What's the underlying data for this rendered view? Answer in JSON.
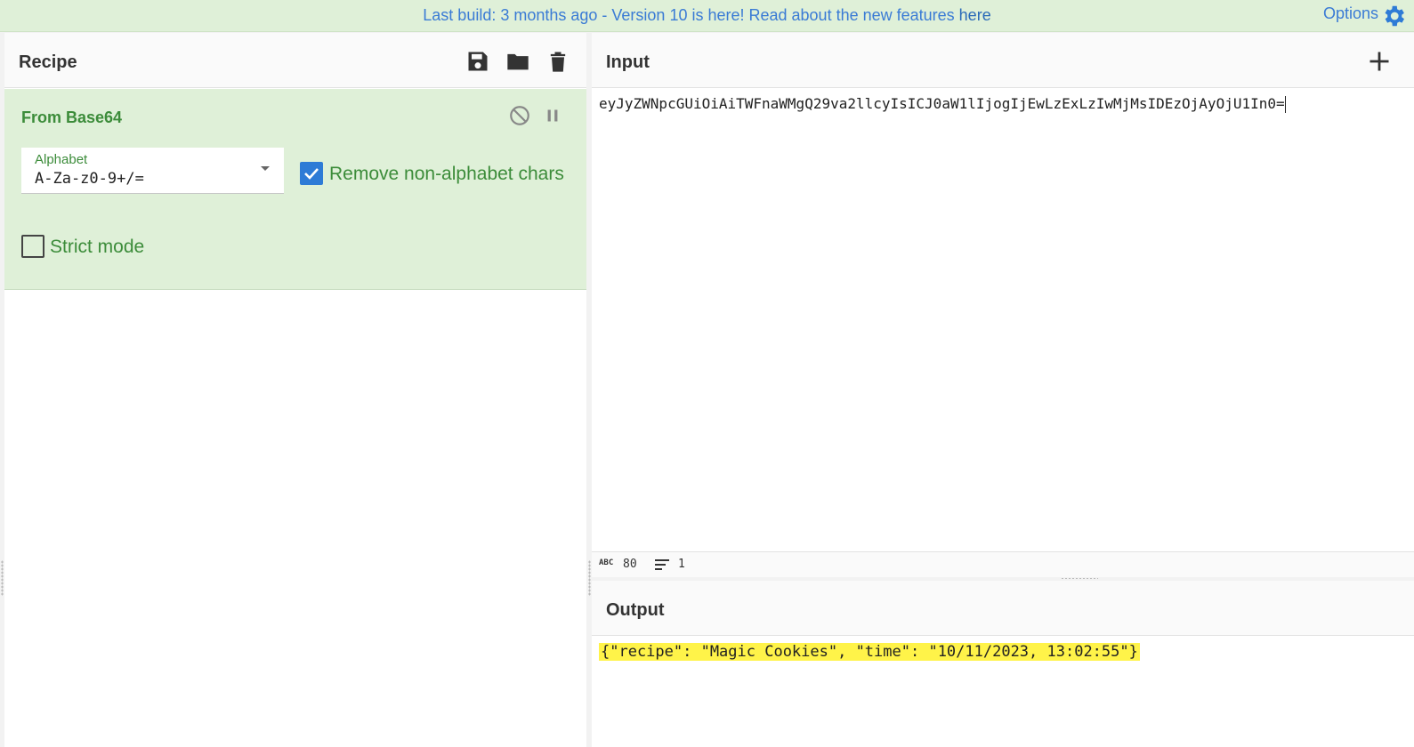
{
  "banner": {
    "text_prefix": "Last build: 3 months ago - Version 10 is here! Read about the new features ",
    "link_text": "here",
    "options_label": "Options"
  },
  "recipe": {
    "title": "Recipe",
    "tools": [
      "save-icon",
      "folder-icon",
      "trash-icon"
    ],
    "operation": {
      "title": "From Base64",
      "alphabet_label": "Alphabet",
      "alphabet_value": "A-Za-z0-9+/=",
      "remove_non_alphabet": {
        "label": "Remove non-alphabet chars",
        "checked": true
      },
      "strict_mode": {
        "label": "Strict mode",
        "checked": false
      }
    }
  },
  "input": {
    "title": "Input",
    "value": "eyJyZWNpcGUiOiAiTWFnaWMgQ29va2llcyIsICJ0aW1lIjogIjEwLzExLzIwMjMsIDEzOjAyOjU1In0=",
    "status": {
      "length_badge": "ABC",
      "length": "80",
      "lines": "1"
    }
  },
  "output": {
    "title": "Output",
    "value": "{\"recipe\": \"Magic Cookies\", \"time\": \"10/11/2023, 13:02:55\"}"
  },
  "colors": {
    "accent_blue": "#3a7bd5",
    "recipe_green": "#3c8c3a",
    "banner_bg": "#dff0d8",
    "highlight": "#fff349"
  }
}
